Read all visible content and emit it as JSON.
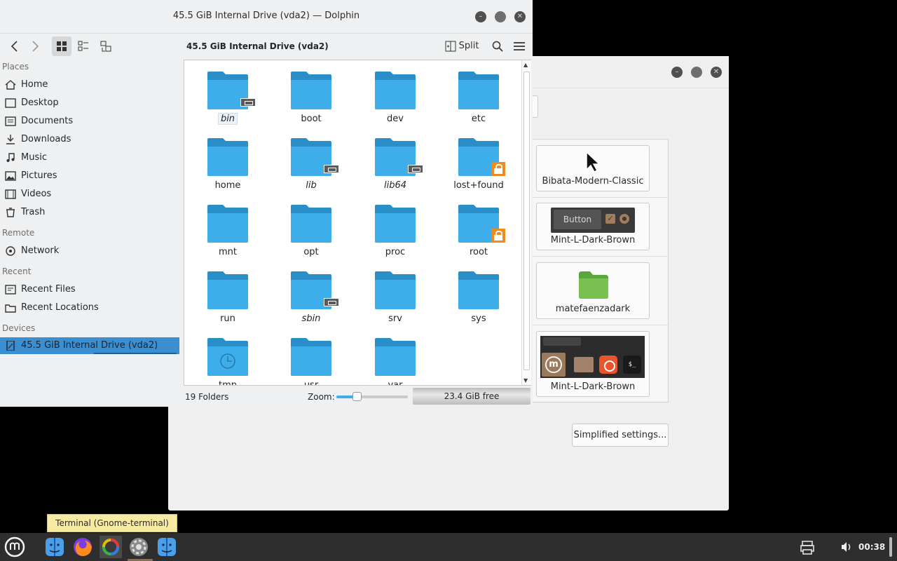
{
  "dolphin": {
    "title": "45.5 GiB Internal Drive (vda2) — Dolphin",
    "location_title": "45.5 GiB Internal Drive (vda2)",
    "split_label": "Split",
    "places": {
      "sections": [
        {
          "heading": "Places",
          "items": [
            "Home",
            "Desktop",
            "Documents",
            "Downloads",
            "Music",
            "Pictures",
            "Videos",
            "Trash"
          ]
        },
        {
          "heading": "Remote",
          "items": [
            "Network"
          ]
        },
        {
          "heading": "Recent",
          "items": [
            "Recent Files",
            "Recent Locations"
          ]
        },
        {
          "heading": "Devices",
          "items": [
            "45.5 GiB Internal Drive (vda2)"
          ]
        }
      ]
    },
    "files": [
      {
        "name": "bin",
        "link": true,
        "lock": false
      },
      {
        "name": "boot",
        "link": false,
        "lock": false
      },
      {
        "name": "dev",
        "link": false,
        "lock": false
      },
      {
        "name": "etc",
        "link": false,
        "lock": false
      },
      {
        "name": "home",
        "link": false,
        "lock": false
      },
      {
        "name": "lib",
        "link": true,
        "lock": false
      },
      {
        "name": "lib64",
        "link": true,
        "lock": false
      },
      {
        "name": "lost+found",
        "link": false,
        "lock": true
      },
      {
        "name": "mnt",
        "link": false,
        "lock": false
      },
      {
        "name": "opt",
        "link": false,
        "lock": false
      },
      {
        "name": "proc",
        "link": false,
        "lock": false
      },
      {
        "name": "root",
        "link": false,
        "lock": true
      },
      {
        "name": "run",
        "link": false,
        "lock": false
      },
      {
        "name": "sbin",
        "link": true,
        "lock": false
      },
      {
        "name": "srv",
        "link": false,
        "lock": false
      },
      {
        "name": "sys",
        "link": false,
        "lock": false
      },
      {
        "name": "tmp",
        "link": false,
        "lock": false,
        "clock": true
      },
      {
        "name": "usr",
        "link": false,
        "lock": false
      },
      {
        "name": "var",
        "link": false,
        "lock": false
      }
    ],
    "status": {
      "count": "19 Folders",
      "zoom_label": "Zoom:",
      "zoom_level": 0.28,
      "free": "23.4 GiB free"
    }
  },
  "themes_window": {
    "themes": [
      {
        "name": "Bibata-Modern-Classic"
      },
      {
        "name": "Mint-L-Dark-Brown",
        "button_label": "Button"
      },
      {
        "name": "matefaenzadark"
      },
      {
        "name": "Mint-L-Dark-Brown",
        "terminal_glyph": "$_"
      }
    ],
    "simplified_button": "Simplified settings..."
  },
  "taskbar": {
    "tooltip": "Terminal (Gnome-terminal)",
    "clock": "00:38"
  },
  "colors": {
    "folder": "#3daee9",
    "folder_tab": "#2a8fc8",
    "selection": "#3b8ed0",
    "lock": "#f08a1c",
    "taskbar": "#2e2e2e"
  }
}
